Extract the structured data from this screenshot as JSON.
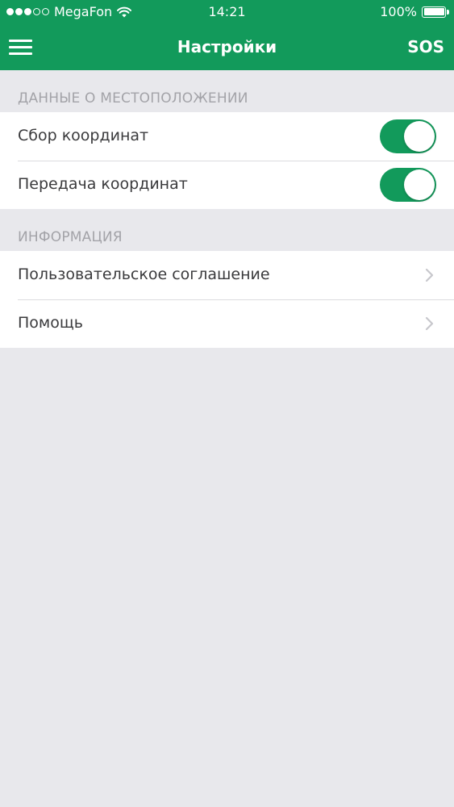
{
  "status_bar": {
    "carrier": "MegaFon",
    "time": "14:21",
    "battery": "100%",
    "battery_level": 1.0,
    "signal_bars_filled": 3,
    "signal_bars_total": 5
  },
  "nav": {
    "title": "Настройки",
    "sos_label": "SOS",
    "menu_icon": "hamburger-menu-icon"
  },
  "sections": {
    "location": {
      "header": "ДАННЫЕ О МЕСТОПОЛОЖЕНИИ",
      "items": [
        {
          "label": "Сбор координат",
          "enabled": true
        },
        {
          "label": "Передача координат",
          "enabled": true
        }
      ]
    },
    "info": {
      "header": "ИНФОРМАЦИЯ",
      "items": [
        {
          "label": "Пользовательское соглашение",
          "icon": "chevron-right-icon"
        },
        {
          "label": "Помощь",
          "icon": "chevron-right-icon"
        }
      ]
    }
  },
  "colors": {
    "brand": "#129a5b",
    "background": "#e8e8ec",
    "section_header_text": "#a3a3a8",
    "row_text": "#3a3a3c",
    "chevron": "#c7c7cc"
  }
}
